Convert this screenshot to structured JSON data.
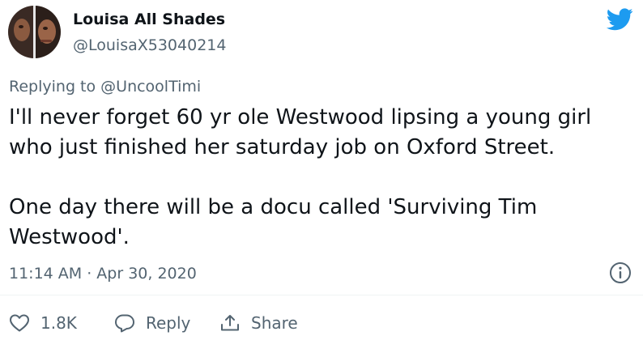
{
  "tweet": {
    "author_name": "Louisa All Shades",
    "author_handle": "@LouisaX53040214",
    "replying_to": "Replying to @UncoolTimi",
    "paragraphs": [
      "I'll never forget 60 yr ole Westwood lipsing a young girl who just finished her saturday job on Oxford Street.",
      "One day there will be a docu called 'Surviving Tim Westwood'."
    ],
    "timestamp": "11:14 AM · Apr 30, 2020"
  },
  "actions": {
    "like_count": "1.8K",
    "reply_label": "Reply",
    "share_label": "Share"
  },
  "icons": {
    "logo": "twitter-bird-icon",
    "info": "info-icon",
    "like": "heart-icon",
    "reply": "speech-bubble-icon",
    "share": "share-upload-icon"
  },
  "colors": {
    "twitter_blue": "#1d9bf0",
    "text_primary": "#0f1419",
    "text_secondary": "#536471"
  }
}
